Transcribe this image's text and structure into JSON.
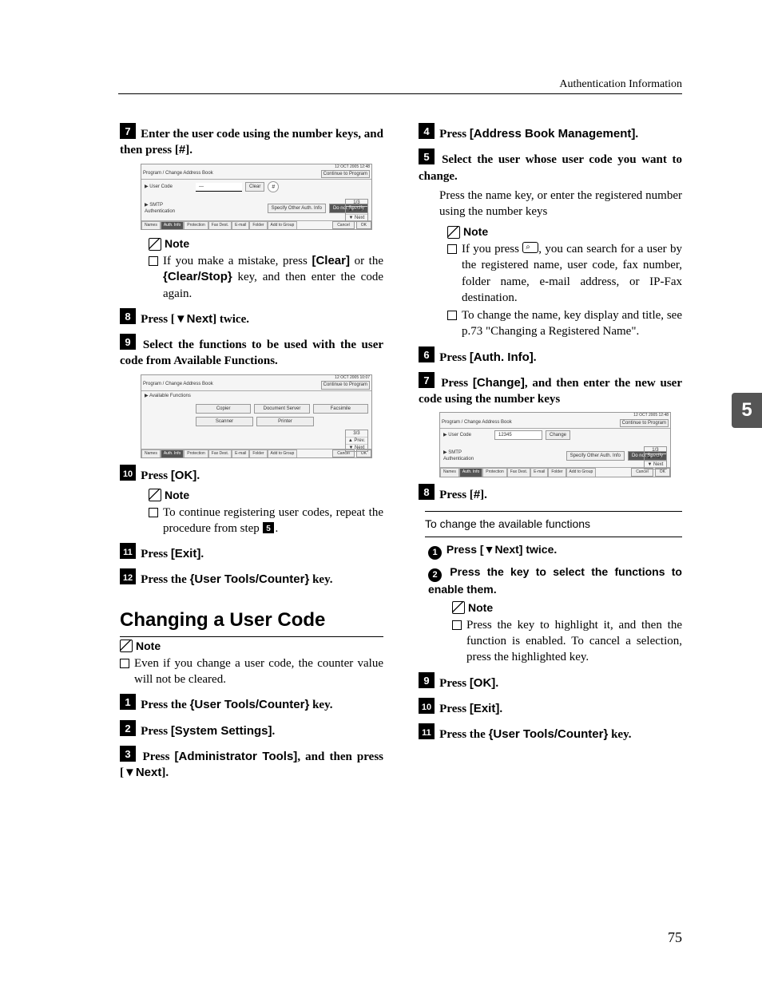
{
  "header": "Authentication Information",
  "page_number": "75",
  "tab_label": "5",
  "left": {
    "step7": {
      "text": "Enter the user code using the number keys, and then press [",
      "key": "#",
      "after": "]."
    },
    "fig1": {
      "datetime": "12  OCT   2005 12:48",
      "title": "Program / Change Address Book",
      "cont": "Continue to Program",
      "ucode": "▶ User Code",
      "clear": "Clear",
      "hash": "#",
      "smtp": "▶ SMTP Authentication",
      "specify": "Specify Other Auth. Info",
      "donot": "Do not Specify",
      "page": "1/3",
      "prev": "▲ Prev.",
      "next": "▼ Next",
      "tabs": [
        "Names",
        "Auth. Info",
        "Protection",
        "Fax Dest.",
        "E-mail",
        "Folder",
        "Add to Group"
      ],
      "cancel": "Cancel",
      "ok": "OK"
    },
    "note1": {
      "heading": "Note",
      "item": "If you make a mistake, press ",
      "clear": "[Clear]",
      "mid": " or the ",
      "clearstop": "Clear/Stop",
      "after": " key, and then enter the code again."
    },
    "step8": {
      "prefix": "Press [",
      "key": "▼Next",
      "suffix": "] twice."
    },
    "step9": "Select the functions to be used with the user code from Available Functions.",
    "fig2": {
      "datetime": "12  OCT   2005 10:07",
      "title": "Program / Change Address Book",
      "cont": "Continue to Program",
      "avail": "▶ Available Functions",
      "btns": [
        "Copier",
        "Document Server",
        "Facsimile",
        "Scanner",
        "Printer"
      ],
      "page": "3/3",
      "prev": "▲ Prev.",
      "next": "▼ Next",
      "tabs": [
        "Names",
        "Auth. Info",
        "Protection",
        "Fax Dest.",
        "E-mail",
        "Folder",
        "Add to Group"
      ],
      "cancel": "Cancel",
      "ok": "OK"
    },
    "step10": {
      "prefix": "Press ",
      "key": "[OK]",
      "suffix": "."
    },
    "note2": {
      "heading": "Note",
      "item": "To continue registering user codes, repeat the procedure from step "
    },
    "step11": {
      "prefix": "Press ",
      "key": "[Exit]",
      "suffix": "."
    },
    "step12": {
      "prefix": "Press the ",
      "key": "User Tools/Counter",
      "suffix": " key."
    },
    "heading": "Changing a User Code",
    "note3": {
      "heading": "Note",
      "item": "Even if you change a user code, the counter value will not be cleared."
    },
    "cstep1": {
      "prefix": "Press the ",
      "key": "User Tools/Counter",
      "suffix": " key."
    },
    "cstep2": {
      "prefix": "Press ",
      "key": "[System Settings]",
      "suffix": "."
    },
    "cstep3": {
      "prefix": "Press ",
      "key": "[Administrator Tools]",
      "mid": ", and then press [",
      "key2": "▼Next",
      "suffix": "]."
    }
  },
  "right": {
    "step4": {
      "prefix": "Press ",
      "key": "[Address Book Management]",
      "suffix": "."
    },
    "step5": "Select the user whose user code you want to change.",
    "step5_body": "Press the name key, or enter the registered number using the number keys",
    "note1": {
      "heading": "Note",
      "item1a": "If you press ",
      "item1b": ", you can search for a user by the registered name, user code, fax number, folder name, e-mail address, or IP-Fax destination.",
      "item2": "To change the name, key display and title, see p.73 \"Changing a Registered Name\"."
    },
    "step6": {
      "prefix": "Press ",
      "key": "[Auth. Info]",
      "suffix": "."
    },
    "step7": {
      "prefix": "Press ",
      "key": "[Change]",
      "suffix": ", and then enter the new user code using the number keys"
    },
    "fig3": {
      "datetime": "12  OCT   2005 12:48",
      "title": "Program / Change Address Book",
      "cont": "Continue to Program",
      "ucode": "▶ User Code",
      "value": "12345",
      "change": "Change",
      "smtp": "▶ SMTP Authentication",
      "specify": "Specify Other Auth. Info",
      "donot": "Do not Specify",
      "page": "1/3",
      "prev": "▲ Prev.",
      "next": "▼ Next",
      "tabs": [
        "Names",
        "Auth. Info",
        "Protection",
        "Fax Dest.",
        "E-mail",
        "Folder",
        "Add to Group"
      ],
      "cancel": "Cancel",
      "ok": "OK"
    },
    "step8": {
      "prefix": "Press [",
      "key": "#",
      "suffix": "]."
    },
    "box_title": "To change the available functions",
    "sub1": {
      "prefix": "Press [",
      "key": "▼Next",
      "suffix": "] twice."
    },
    "sub2": "Press the key to select the functions to enable them.",
    "subnote": {
      "heading": "Note",
      "item": "Press the key to highlight it, and then the function is enabled. To cancel a selection, press the highlighted key."
    },
    "step9": {
      "prefix": "Press ",
      "key": "[OK]",
      "suffix": "."
    },
    "step10": {
      "prefix": "Press ",
      "key": "[Exit]",
      "suffix": "."
    },
    "step11": {
      "prefix": "Press the ",
      "key": "User Tools/Counter",
      "suffix": " key."
    }
  }
}
